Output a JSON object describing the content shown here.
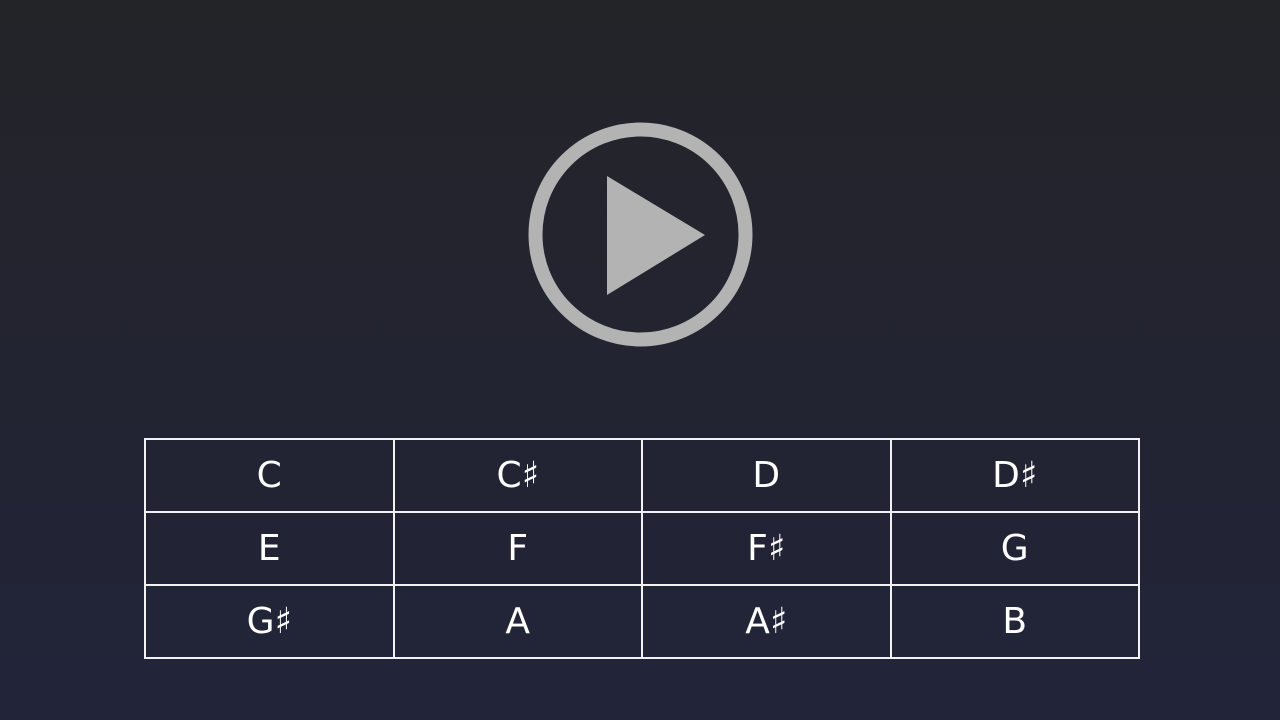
{
  "player": {
    "play_icon": "play-circle-icon",
    "icon_color": "#b3b3b3"
  },
  "notes": {
    "rows": [
      [
        "C",
        "C♯",
        "D",
        "D♯"
      ],
      [
        "E",
        "F",
        "F♯",
        "G"
      ],
      [
        "G♯",
        "A",
        "A♯",
        "B"
      ]
    ]
  }
}
